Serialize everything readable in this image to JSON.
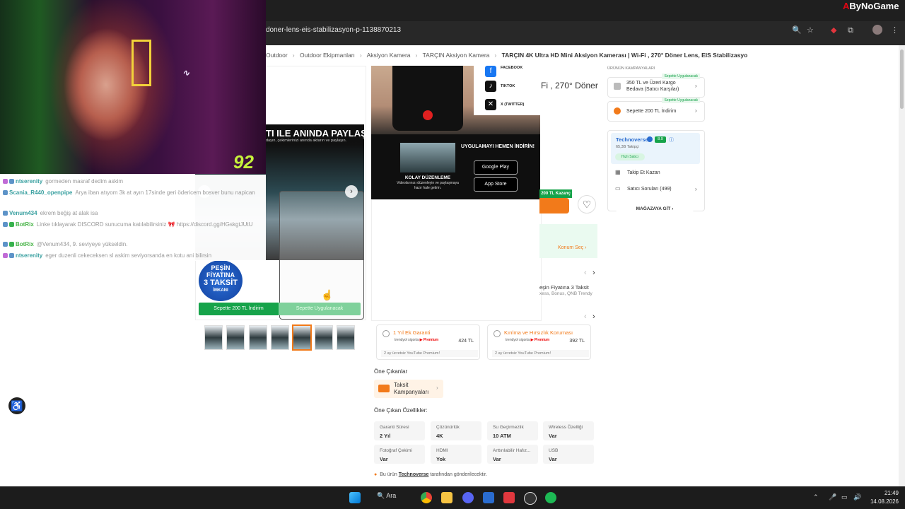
{
  "browser": {
    "url_fragment": "doner-lens-eis-stabilizasyon-p-1138870213",
    "brand_logo": "ByNoGame"
  },
  "breadcrumb": [
    "Outdoor",
    "Outdoor Ekipmanları",
    "Aksiyon Kamera",
    "TARÇIN Aksiyon Kamera",
    "TARÇIN 4K Ultra HD Mini Aksiyon Kamerası | Wi-Fi , 270° Döner Lens, EIS Stabilizasyo"
  ],
  "webcam": {
    "overlay_number": "92"
  },
  "chat": [
    {
      "user": "ntserenity",
      "msg": "gormeden masraf dedim askim",
      "type": "user"
    },
    {
      "user": "Scania_R440_openpipe",
      "msg": "Arya iban atıyom 3k at ayın 17sinde geri ödericem bosver bunu napican",
      "type": "user"
    },
    {
      "user": "Venum434",
      "msg": "ekrem beğiş at alak isa",
      "type": "user"
    },
    {
      "user": "BotRix",
      "msg": "Linke tıklayarak DISCORD sunucuma katılabilirsiniz 🎀 https://discord.gg/HGskgtJUtU",
      "type": "bot"
    },
    {
      "user": "BotRix",
      "msg": "@Venum434, 9. seviyeye yükseldin.",
      "type": "bot"
    },
    {
      "user": "ntserenity",
      "msg": "eger duzenli cekeceksen sl askim seviyorsanda en kotu ani bilirsin",
      "type": "user"
    }
  ],
  "gallery": {
    "headline": "TI ILE ANINDA PAYLAŞ!",
    "subline": "dayın, çekimlerinizi anında aktarın ve paylaşın.",
    "pesin_badge": [
      "PEŞİN",
      "FİYATINA",
      "3 TAKSİT",
      "İMKANI"
    ],
    "btn_200": "Sepette 200 TL İndirim",
    "btn_uyg": "Sepette Uygulanacak"
  },
  "mid_image": {
    "social": [
      "FACEBOOK",
      "TIKTOK",
      "X (TWITTER)"
    ],
    "uyg_title": "UYGULAMAYI HEMEN İNDİRİN!",
    "store_google": "Google Play",
    "store_apple": "App Store",
    "kolay": "KOLAY DÜZENLEME",
    "kolay_sub": "Videolarınızı düzenleyin ve paylaşmaya hazır hale getirin."
  },
  "product": {
    "title_fragment": "Fi , 270° Döner",
    "kazanc": "200 TL Kazanç",
    "konum": "Konum Seç",
    "taksit_text": "eşin Fiyatına 3 Taksit",
    "taksit_sub": "xess, Bonus, QNB Trendy"
  },
  "warranty": [
    {
      "title": "1 Yıl Ek Garanti",
      "brand": "trendyol sigorta",
      "price": "424 TL",
      "sub": "2 ay ücretsiz YouTube Premium!"
    },
    {
      "title": "Kırılma ve Hırsızlık Koruması",
      "brand": "trendyol sigorta",
      "price": "392 TL",
      "sub": "2 ay ücretsiz YouTube Premium!"
    }
  ],
  "highlights": {
    "title": "Öne Çıkanlar",
    "taksit_label": "Taksit Kampanyaları",
    "features_title": "Öne Çıkan Özellikler:",
    "specs": [
      {
        "key": "Garanti Süresi",
        "value": "2 Yıl"
      },
      {
        "key": "Çözünürlük",
        "value": "4K"
      },
      {
        "key": "Su Geçirmezlik",
        "value": "10 ATM"
      },
      {
        "key": "Wireless Özelliği",
        "value": "Var"
      },
      {
        "key": "Fotoğraf Çekimi",
        "value": "Var"
      },
      {
        "key": "HDMI",
        "value": "Yok"
      },
      {
        "key": "Arttırılabilir Hafız...",
        "value": "Var"
      },
      {
        "key": "USB",
        "value": "Var"
      }
    ],
    "seller_note_pre": "Bu ürün",
    "seller_note_link": "Technoverse",
    "seller_note_post": "tarafından gönderilecektir."
  },
  "sidebar": {
    "campaign_label": "ÜRÜNÜN KAMPANYALARI",
    "campaigns": [
      {
        "tag": "Sepette Uygulanacak",
        "text": "350 TL ve Üzeri Kargo Bedava (Satıcı Karşılar)"
      },
      {
        "tag": "Sepette Uygulanacak",
        "text": "Sepette 200 TL İndirim"
      }
    ],
    "seller": {
      "name": "Technoverse",
      "score": "8.9",
      "followers": "65,3B Takipçi",
      "badge": "Hızlı Satıcı",
      "follow_label": "Takip Et Kazan",
      "questions": "Satıcı Soruları (499)",
      "store_btn": "MAĞAZAYA GİT"
    }
  },
  "taskbar": {
    "search": "Ara",
    "time": "21:49",
    "date": "14.08.2026"
  }
}
